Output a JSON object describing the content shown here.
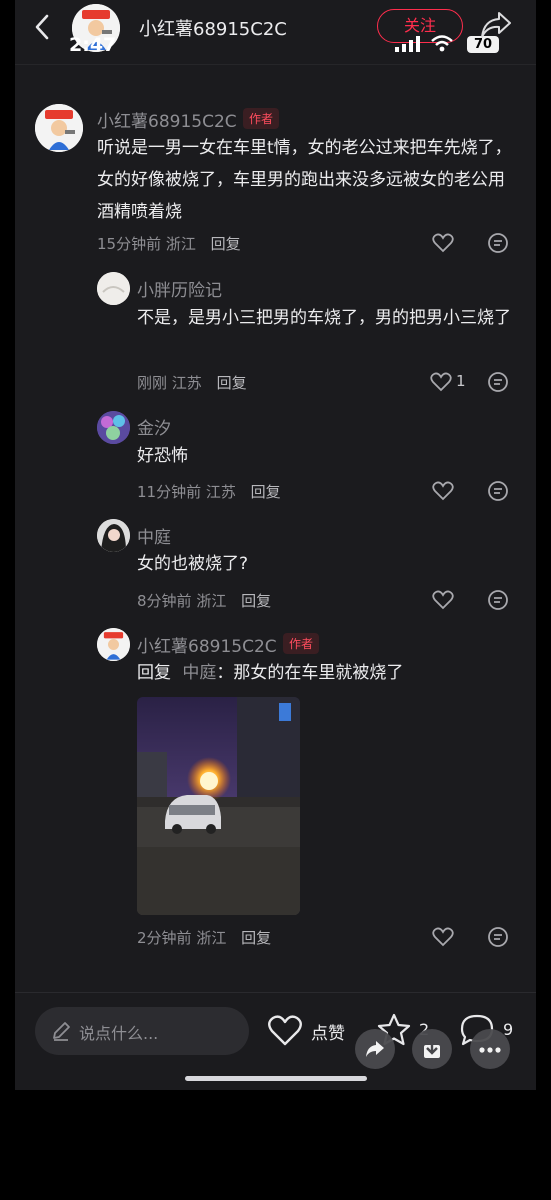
{
  "header": {
    "username": "小红薯68915C2C",
    "time": "2:47",
    "follow_label": "关注",
    "battery": "70"
  },
  "comments": [
    {
      "user": "小红薯68915C2C",
      "badge": "作者",
      "text": "听说是一男一女在车里t情，女的老公过来把车先烧了，女的好像被烧了，车里男的跑出来没多远被女的老公用酒精喷着烧",
      "time": "15分钟前",
      "location": "浙江",
      "reply": "回复"
    }
  ],
  "replies": [
    {
      "user": "小胖历险记",
      "text": "不是，是男小三把男的车烧了，男的把男小三烧了",
      "time": "刚刚",
      "location": "江苏",
      "reply": "回复",
      "likes": "1"
    },
    {
      "user": "金汐",
      "text": "好恐怖",
      "time": "11分钟前",
      "location": "江苏",
      "reply": "回复"
    },
    {
      "user": "中庭",
      "text": "女的也被烧了?",
      "time": "8分钟前",
      "location": "浙江",
      "reply": "回复"
    },
    {
      "user": "小红薯68915C2C",
      "badge": "作者",
      "reply_prefix": "回复",
      "reply_to": "中庭",
      "text": "：那女的在车里就被烧了",
      "time": "2分钟前",
      "location": "浙江",
      "reply": "回复"
    }
  ],
  "bottom_bar": {
    "input_placeholder": "说点什么...",
    "like_label": "点赞",
    "star_count": "2",
    "comment_count": "9"
  },
  "colors": {
    "background": "#1b1b1e",
    "accent": "#ff2e4d",
    "secondary_text": "#8e8e93"
  }
}
